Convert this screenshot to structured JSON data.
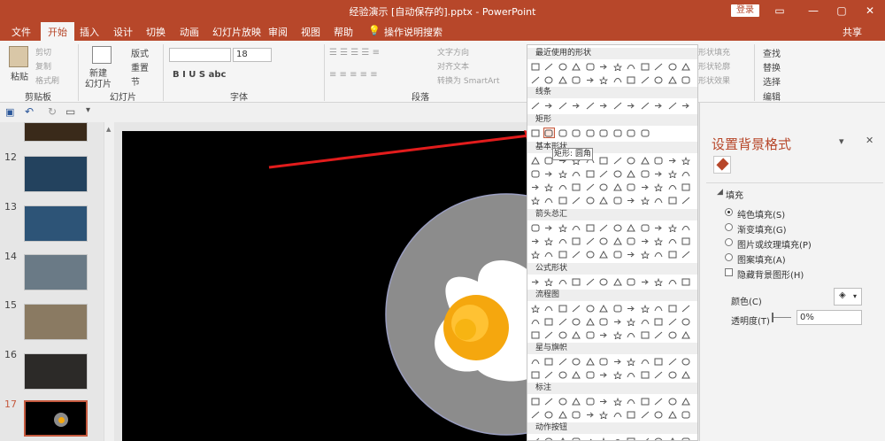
{
  "window": {
    "title": "经验演示 [自动保存的].pptx  -  PowerPoint",
    "login": "登录",
    "minimize": "—",
    "restore": "▢",
    "close": "✕",
    "options": "▭"
  },
  "tabs": [
    "文件",
    "开始",
    "插入",
    "设计",
    "切换",
    "动画",
    "幻灯片放映",
    "审阅",
    "视图",
    "帮助"
  ],
  "active_tab": "开始",
  "tell_me": "操作说明搜索",
  "share": "共享",
  "ribbon": {
    "paste": "粘贴",
    "cut": "剪切",
    "copy": "复制",
    "format_painter": "格式刷",
    "clipboard_group": "剪贴板",
    "new_slide": "新建",
    "new_slide2": "幻灯片",
    "layout": "版式",
    "reset": "重置",
    "section": "节",
    "slides_group": "幻灯片",
    "font_name": "",
    "font_size": "18",
    "font_group": "字体",
    "paragraph_group": "段落",
    "text_direction": "文字方向",
    "align_text": "对齐文本",
    "convert_smartart": "转换为 SmartArt",
    "shape_fill": "形状填充",
    "shape_outline": "形状轮廓",
    "shape_effects": "形状效果",
    "find": "查找",
    "replace": "替换",
    "select": "选择",
    "editing_group": "编辑"
  },
  "slides": [
    {
      "num": "12"
    },
    {
      "num": "13"
    },
    {
      "num": "14"
    },
    {
      "num": "15"
    },
    {
      "num": "16"
    },
    {
      "num": "17"
    }
  ],
  "shape_gallery": {
    "sections": [
      "最近使用的形状",
      "线条",
      "矩形",
      "基本形状",
      "箭头总汇",
      "公式形状",
      "流程图",
      "星与旗帜",
      "标注",
      "动作按钮"
    ],
    "tooltip": "矩形: 圆角"
  },
  "format_pane": {
    "title": "设置背景格式",
    "section": "填充",
    "options": [
      "纯色填充(S)",
      "渐变填充(G)",
      "图片或纹理填充(P)",
      "图案填充(A)",
      "隐藏背景图形(H)"
    ],
    "selected": "纯色填充(S)",
    "color_label": "颜色(C)",
    "transparency_label": "透明度(T)",
    "transparency_value": "0%",
    "pane_close": "✕",
    "pane_dropdown": "▾"
  },
  "colors": {
    "accent": "#b7472a",
    "arrow": "#e21c1c",
    "egg_white": "#ffffff",
    "yolk": "#f5a70e",
    "plate": "#8c8c8c"
  }
}
